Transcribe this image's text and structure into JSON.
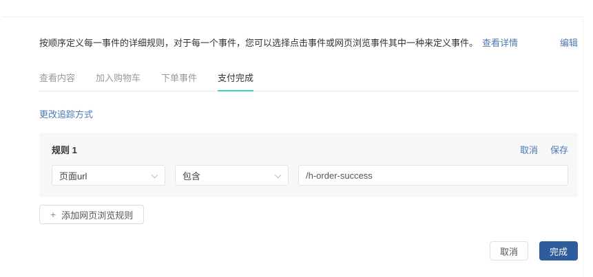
{
  "header": {
    "description": "按顺序定义每一事件的详细规则，对于每一个事件，您可以选择点击事件或网页浏览事件其中一种来定义事件。",
    "details_link": "查看详情",
    "edit_link": "编辑"
  },
  "tabs": [
    {
      "label": "查看内容",
      "active": false
    },
    {
      "label": "加入购物车",
      "active": false
    },
    {
      "label": "下单事件",
      "active": false
    },
    {
      "label": "支付完成",
      "active": true
    }
  ],
  "change_tracking_link": "更改追踪方式",
  "rule": {
    "title": "规则 1",
    "cancel_label": "取消",
    "save_label": "保存",
    "field_select_value": "页面url",
    "operator_select_value": "包含",
    "value_input": "/h-order-success"
  },
  "add_rule_button": {
    "icon": "+",
    "label": "添加网页浏览规则"
  },
  "footer": {
    "cancel_label": "取消",
    "done_label": "完成"
  },
  "colors": {
    "link_blue": "#4e79b2",
    "accent_cyan": "#36d3d0",
    "primary_button": "#2e5c9d"
  }
}
